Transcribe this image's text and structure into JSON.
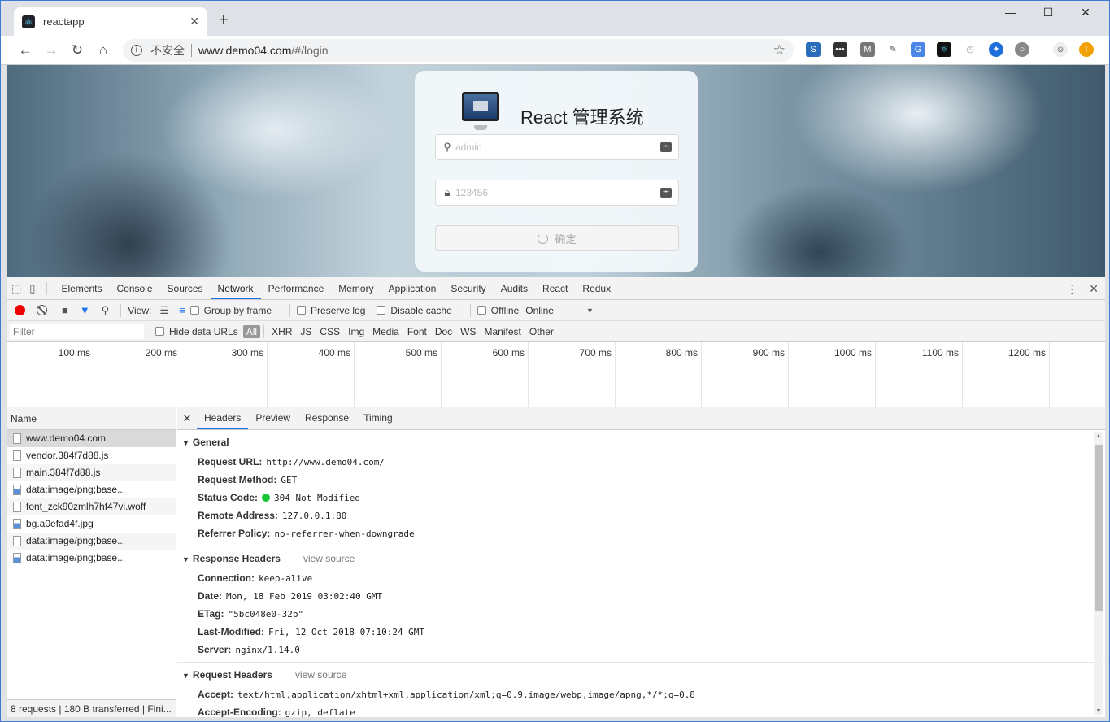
{
  "browser": {
    "tab_title": "reactapp",
    "new_tab": "+",
    "omnibox": {
      "security": "不安全",
      "host": "www.demo04.com",
      "path": "/#/login"
    }
  },
  "login": {
    "title": "React 管理系统",
    "username_placeholder": "admin",
    "password_placeholder": "123456",
    "submit_label": "确定"
  },
  "devtools": {
    "tabs": [
      "Elements",
      "Console",
      "Sources",
      "Network",
      "Performance",
      "Memory",
      "Application",
      "Security",
      "Audits",
      "React",
      "Redux"
    ],
    "active_tab": "Network",
    "toolbar": {
      "view_label": "View:",
      "group_by_frame": "Group by frame",
      "preserve_log": "Preserve log",
      "disable_cache": "Disable cache",
      "offline": "Offline",
      "throttle": "Online"
    },
    "filter": {
      "placeholder": "Filter",
      "hide_data_urls": "Hide data URLs",
      "types": [
        "All",
        "XHR",
        "JS",
        "CSS",
        "Img",
        "Media",
        "Font",
        "Doc",
        "WS",
        "Manifest",
        "Other"
      ]
    },
    "timeline": [
      "100 ms",
      "200 ms",
      "300 ms",
      "400 ms",
      "500 ms",
      "600 ms",
      "700 ms",
      "800 ms",
      "900 ms",
      "1000 ms",
      "1100 ms",
      "1200 ms"
    ],
    "requests": {
      "header": "Name",
      "items": [
        "www.demo04.com",
        "vendor.384f7d88.js",
        "main.384f7d88.js",
        "data:image/png;base...",
        "font_zck90zmlh7hf47vi.woff",
        "bg.a0efad4f.jpg",
        "data:image/png;base...",
        "data:image/png;base..."
      ],
      "status": "8 requests | 180 B transferred | Fini..."
    },
    "detail": {
      "tabs": [
        "Headers",
        "Preview",
        "Response",
        "Timing"
      ],
      "general": {
        "title": "General",
        "rows": [
          {
            "k": "Request URL:",
            "v": "http://www.demo04.com/"
          },
          {
            "k": "Request Method:",
            "v": "GET"
          },
          {
            "k": "Status Code:",
            "v": "304 Not Modified"
          },
          {
            "k": "Remote Address:",
            "v": "127.0.0.1:80"
          },
          {
            "k": "Referrer Policy:",
            "v": "no-referrer-when-downgrade"
          }
        ]
      },
      "response_headers": {
        "title": "Response Headers",
        "view_source": "view source",
        "rows": [
          {
            "k": "Connection:",
            "v": "keep-alive"
          },
          {
            "k": "Date:",
            "v": "Mon, 18 Feb 2019 03:02:40 GMT"
          },
          {
            "k": "ETag:",
            "v": "\"5bc048e0-32b\""
          },
          {
            "k": "Last-Modified:",
            "v": "Fri, 12 Oct 2018 07:10:24 GMT"
          },
          {
            "k": "Server:",
            "v": "nginx/1.14.0"
          }
        ]
      },
      "request_headers": {
        "title": "Request Headers",
        "view_source": "view source",
        "rows": [
          {
            "k": "Accept:",
            "v": "text/html,application/xhtml+xml,application/xml;q=0.9,image/webp,image/apng,*/*;q=0.8"
          },
          {
            "k": "Accept-Encoding:",
            "v": "gzip, deflate"
          }
        ]
      }
    }
  }
}
